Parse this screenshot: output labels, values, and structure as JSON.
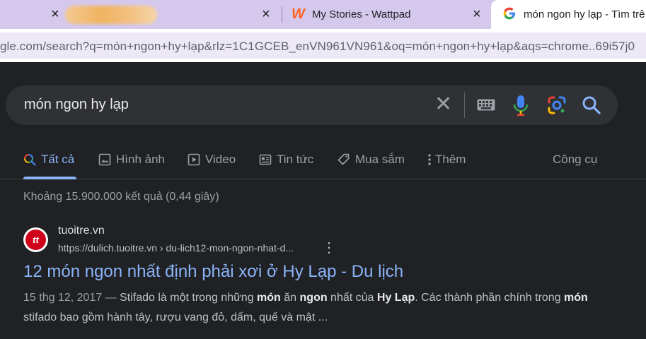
{
  "tabs": [
    {
      "title": "",
      "close": "×"
    },
    {
      "title": "My Stories - Wattpad",
      "close": "×",
      "icon": "wattpad-icon",
      "icon_glyph": "W"
    },
    {
      "title": "món ngon hy lạp - Tìm trê",
      "icon": "google-icon"
    }
  ],
  "address_bar": {
    "url_domain": "gle.com",
    "url_path": "/search?q=món+ngon+hy+lạp&rlz=1C1GCEB_enVN961VN961&oq=món+ngon+hy+lạp&aqs=chrome..69i57j0"
  },
  "search": {
    "query": "món ngon hy lạp",
    "clear_glyph": "✕"
  },
  "nav": {
    "all": "Tất cả",
    "images": "Hình ảnh",
    "video": "Video",
    "news": "Tin tức",
    "shopping": "Mua sắm",
    "more": "Thêm",
    "tools": "Công cụ"
  },
  "stats": "Khoảng 15.900.000 kết quả (0,44 giây)",
  "result": {
    "favicon_text": "tt",
    "site_name": "tuoitre.vn",
    "cite_url": "https://dulich.tuoitre.vn › du-lich12-mon-ngon-nhat-d...",
    "more_glyph": "⋮",
    "title": "12 món ngon nhất định phải xơi ở Hy Lạp - Du lịch",
    "snippet": {
      "date": "15 thg 12, 2017 — ",
      "p1": "Stifado là một trong những ",
      "b1": "món",
      "p2": " ăn ",
      "b2": "ngon",
      "p3": " nhất của ",
      "b3": "Hy Lạp",
      "p4": ". Các thành phần chính trong ",
      "b4": "món",
      "p5": " stifado bao gồm hành tây, rượu vang đỏ, dấm, quế và mật ..."
    }
  },
  "colors": {
    "tabstrip": "#d4c8ec",
    "background": "#202124",
    "link": "#8ab4f8",
    "wattpad": "#ff6122"
  }
}
